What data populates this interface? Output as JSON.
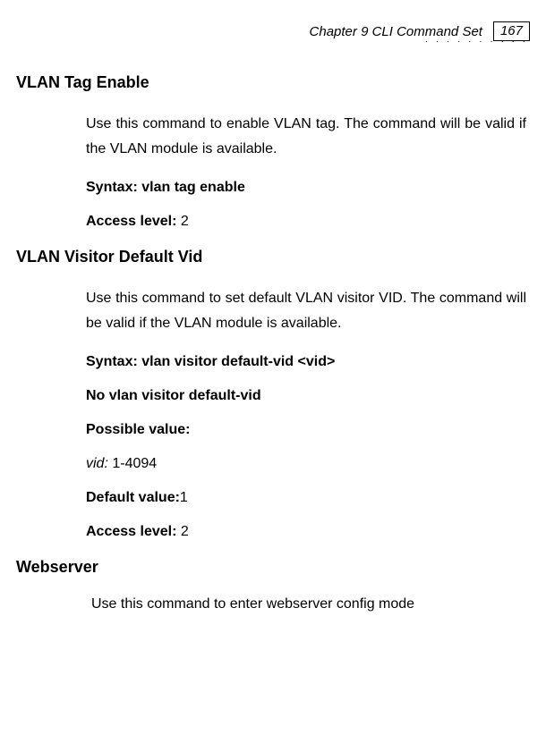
{
  "header": {
    "chapter": "Chapter 9 CLI Command Set",
    "page_number": "167",
    "dots": "· · · · · · · · · ·"
  },
  "sections": {
    "vlan_tag_enable": {
      "title": "VLAN Tag Enable",
      "desc": "Use this command to enable VLAN tag. The command will be valid if the VLAN module is available.",
      "syntax_label": "Syntax: vlan tag enable",
      "access_label": "Access level: ",
      "access_value": "2"
    },
    "vlan_visitor_default_vid": {
      "title": "VLAN Visitor Default Vid",
      "desc": "Use this command to set default VLAN visitor VID. The command will be valid if the VLAN module is available.",
      "syntax_label": "Syntax: vlan visitor default-vid <vid>",
      "syntax_no": "No vlan visitor default-vid",
      "possible_label": "Possible value:",
      "vid_label": "vid: ",
      "vid_value": "1-4094",
      "default_label": "Default value:",
      "default_value": "1",
      "access_label": "Access level: ",
      "access_value": "2"
    },
    "webserver": {
      "title": "Webserver",
      "desc": "Use this command to enter webserver config mode"
    }
  }
}
